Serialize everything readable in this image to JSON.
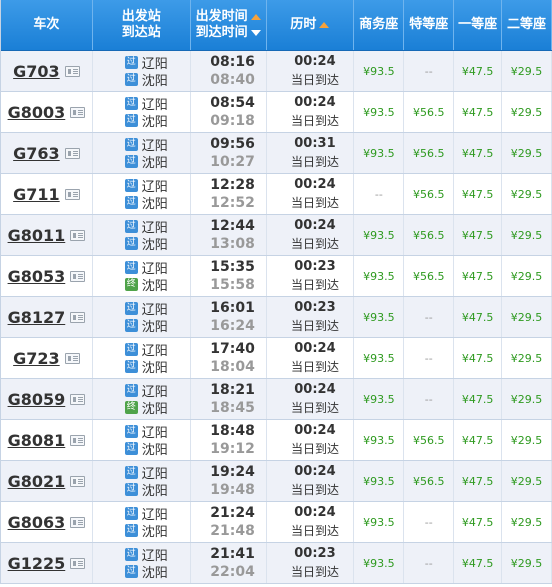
{
  "header": {
    "train": "车次",
    "station_dep": "出发站",
    "station_arr": "到达站",
    "time_dep": "出发时间",
    "time_arr": "到达时间",
    "duration": "历时",
    "business": "商务座",
    "special": "特等座",
    "first": "一等座",
    "second": "二等座"
  },
  "rows": [
    {
      "train": "G703",
      "from": "辽阳",
      "to": "沈阳",
      "from_badge": "过",
      "to_badge": "过",
      "dep": "08:16",
      "arr": "08:40",
      "dur": "00:24",
      "day": "当日到达",
      "biz": "¥93.5",
      "spec": "--",
      "first": "¥47.5",
      "second": "¥29.5"
    },
    {
      "train": "G8003",
      "from": "辽阳",
      "to": "沈阳",
      "from_badge": "过",
      "to_badge": "过",
      "dep": "08:54",
      "arr": "09:18",
      "dur": "00:24",
      "day": "当日到达",
      "biz": "¥93.5",
      "spec": "¥56.5",
      "first": "¥47.5",
      "second": "¥29.5"
    },
    {
      "train": "G763",
      "from": "辽阳",
      "to": "沈阳",
      "from_badge": "过",
      "to_badge": "过",
      "dep": "09:56",
      "arr": "10:27",
      "dur": "00:31",
      "day": "当日到达",
      "biz": "¥93.5",
      "spec": "¥56.5",
      "first": "¥47.5",
      "second": "¥29.5"
    },
    {
      "train": "G711",
      "from": "辽阳",
      "to": "沈阳",
      "from_badge": "过",
      "to_badge": "过",
      "dep": "12:28",
      "arr": "12:52",
      "dur": "00:24",
      "day": "当日到达",
      "biz": "--",
      "spec": "¥56.5",
      "first": "¥47.5",
      "second": "¥29.5"
    },
    {
      "train": "G8011",
      "from": "辽阳",
      "to": "沈阳",
      "from_badge": "过",
      "to_badge": "过",
      "dep": "12:44",
      "arr": "13:08",
      "dur": "00:24",
      "day": "当日到达",
      "biz": "¥93.5",
      "spec": "¥56.5",
      "first": "¥47.5",
      "second": "¥29.5"
    },
    {
      "train": "G8053",
      "from": "辽阳",
      "to": "沈阳",
      "from_badge": "过",
      "to_badge": "终",
      "dep": "15:35",
      "arr": "15:58",
      "dur": "00:23",
      "day": "当日到达",
      "biz": "¥93.5",
      "spec": "¥56.5",
      "first": "¥47.5",
      "second": "¥29.5"
    },
    {
      "train": "G8127",
      "from": "辽阳",
      "to": "沈阳",
      "from_badge": "过",
      "to_badge": "过",
      "dep": "16:01",
      "arr": "16:24",
      "dur": "00:23",
      "day": "当日到达",
      "biz": "¥93.5",
      "spec": "--",
      "first": "¥47.5",
      "second": "¥29.5"
    },
    {
      "train": "G723",
      "from": "辽阳",
      "to": "沈阳",
      "from_badge": "过",
      "to_badge": "过",
      "dep": "17:40",
      "arr": "18:04",
      "dur": "00:24",
      "day": "当日到达",
      "biz": "¥93.5",
      "spec": "--",
      "first": "¥47.5",
      "second": "¥29.5"
    },
    {
      "train": "G8059",
      "from": "辽阳",
      "to": "沈阳",
      "from_badge": "过",
      "to_badge": "终",
      "dep": "18:21",
      "arr": "18:45",
      "dur": "00:24",
      "day": "当日到达",
      "biz": "¥93.5",
      "spec": "--",
      "first": "¥47.5",
      "second": "¥29.5"
    },
    {
      "train": "G8081",
      "from": "辽阳",
      "to": "沈阳",
      "from_badge": "过",
      "to_badge": "过",
      "dep": "18:48",
      "arr": "19:12",
      "dur": "00:24",
      "day": "当日到达",
      "biz": "¥93.5",
      "spec": "¥56.5",
      "first": "¥47.5",
      "second": "¥29.5"
    },
    {
      "train": "G8021",
      "from": "辽阳",
      "to": "沈阳",
      "from_badge": "过",
      "to_badge": "过",
      "dep": "19:24",
      "arr": "19:48",
      "dur": "00:24",
      "day": "当日到达",
      "biz": "¥93.5",
      "spec": "¥56.5",
      "first": "¥47.5",
      "second": "¥29.5"
    },
    {
      "train": "G8063",
      "from": "辽阳",
      "to": "沈阳",
      "from_badge": "过",
      "to_badge": "过",
      "dep": "21:24",
      "arr": "21:48",
      "dur": "00:24",
      "day": "当日到达",
      "biz": "¥93.5",
      "spec": "--",
      "first": "¥47.5",
      "second": "¥29.5"
    },
    {
      "train": "G1225",
      "from": "辽阳",
      "to": "沈阳",
      "from_badge": "过",
      "to_badge": "过",
      "dep": "21:41",
      "arr": "22:04",
      "dur": "00:23",
      "day": "当日到达",
      "biz": "¥93.5",
      "spec": "--",
      "first": "¥47.5",
      "second": "¥29.5"
    }
  ],
  "icons": {
    "train_detail": "id-card-icon",
    "pass_station": "pass-station-badge",
    "end_station": "end-station-badge"
  },
  "colors": {
    "header": "#1a7fd6",
    "price": "#2e9a1f",
    "sort_arrow": "#f7a23b"
  }
}
